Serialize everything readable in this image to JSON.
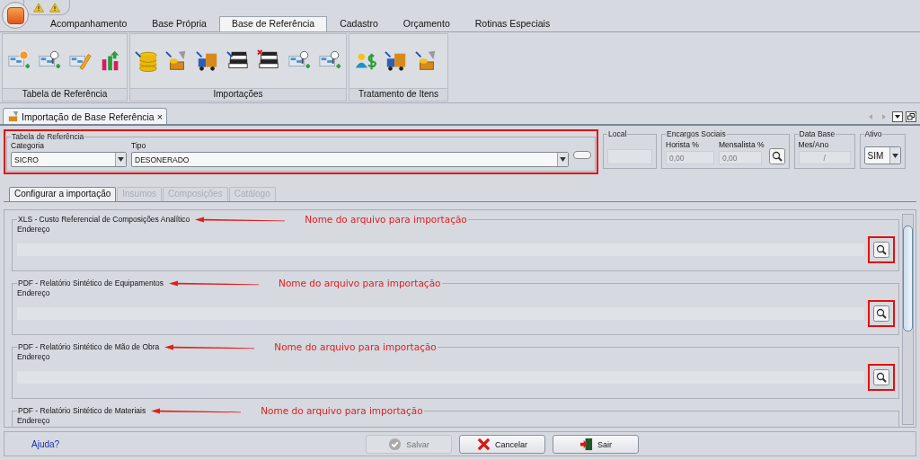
{
  "quick_access": [
    {
      "kind": "warning"
    },
    {
      "kind": "warning"
    }
  ],
  "ribbon_tabs": [
    {
      "label": "Acompanhamento",
      "selected": false
    },
    {
      "label": "Base Própria",
      "selected": false
    },
    {
      "label": "Base de Referência",
      "selected": true
    },
    {
      "label": "Cadastro",
      "selected": false
    },
    {
      "label": "Orçamento",
      "selected": false
    },
    {
      "label": "Rotinas Especiais",
      "selected": false
    }
  ],
  "ribbon_groups": [
    {
      "label": "Tabela de Referência",
      "buttons": [
        {
          "kind": "table-add"
        },
        {
          "kind": "table-search"
        },
        {
          "kind": "table-edit"
        },
        {
          "kind": "chart"
        }
      ]
    },
    {
      "label": "Importações",
      "buttons": [
        {
          "kind": "database"
        },
        {
          "kind": "tools"
        },
        {
          "kind": "truck"
        },
        {
          "kind": "books"
        },
        {
          "kind": "books-delete"
        },
        {
          "kind": "table-search"
        },
        {
          "kind": "table-search"
        }
      ]
    },
    {
      "label": "Tratamento de Itens",
      "buttons": [
        {
          "kind": "people-money"
        },
        {
          "kind": "truck"
        },
        {
          "kind": "tools"
        }
      ]
    }
  ],
  "document_tabs": [
    {
      "label": "Importação de Base Referência",
      "close": "×",
      "selected": true
    }
  ],
  "reference_table": {
    "legend": "Tabela de Referência",
    "highlighted": true,
    "category": {
      "label": "Categoria",
      "value": "SICRO"
    },
    "type": {
      "label": "Tipo",
      "value": "DESONERADO"
    }
  },
  "local": {
    "legend": "Local"
  },
  "social_charges": {
    "legend": "Encargos Sociais",
    "hourly": {
      "label": "Horista %",
      "value": "0,00"
    },
    "monthly": {
      "label": "Mensalista %",
      "value": "0,00"
    }
  },
  "base_date": {
    "legend": "Data Base",
    "label": "Mes/Ano",
    "value": "/"
  },
  "active": {
    "legend": "Ativo",
    "value": "SIM"
  },
  "sub_tabs": [
    {
      "label": "Configurar a importação",
      "selected": true,
      "disabled": false
    },
    {
      "label": "Insumos",
      "selected": false,
      "disabled": true
    },
    {
      "label": "Composições",
      "selected": false,
      "disabled": true
    },
    {
      "label": "Catálogo",
      "selected": false,
      "disabled": true
    }
  ],
  "import_files": [
    {
      "kind": "full",
      "title": "XLS - Custo Referencial de Composições Analítico",
      "field_label": "Endereço",
      "annotation": "Nome do arquivo para importação",
      "highlighted": true
    },
    {
      "kind": "full",
      "title": "PDF - Relatório Sintético de Equipamentos",
      "field_label": "Endereço",
      "annotation": "Nome do arquivo para importação",
      "highlighted": true
    },
    {
      "kind": "full",
      "title": "PDF - Relatório Sintético de Mão de Obra",
      "field_label": "Endereço",
      "annotation": "Nome do arquivo para importação",
      "highlighted": true
    },
    {
      "kind": "partial",
      "title": "PDF - Relatório Sintético de Materiais",
      "field_label": "Endereço",
      "annotation": "Nome do arquivo para importação"
    }
  ],
  "footer": {
    "help": "Ajuda?",
    "buttons": [
      {
        "kind": "save",
        "label": "Salvar",
        "disabled": true
      },
      {
        "kind": "cancel",
        "label": "Cancelar",
        "disabled": false
      },
      {
        "kind": "exit",
        "label": "Sair",
        "disabled": false
      }
    ]
  }
}
